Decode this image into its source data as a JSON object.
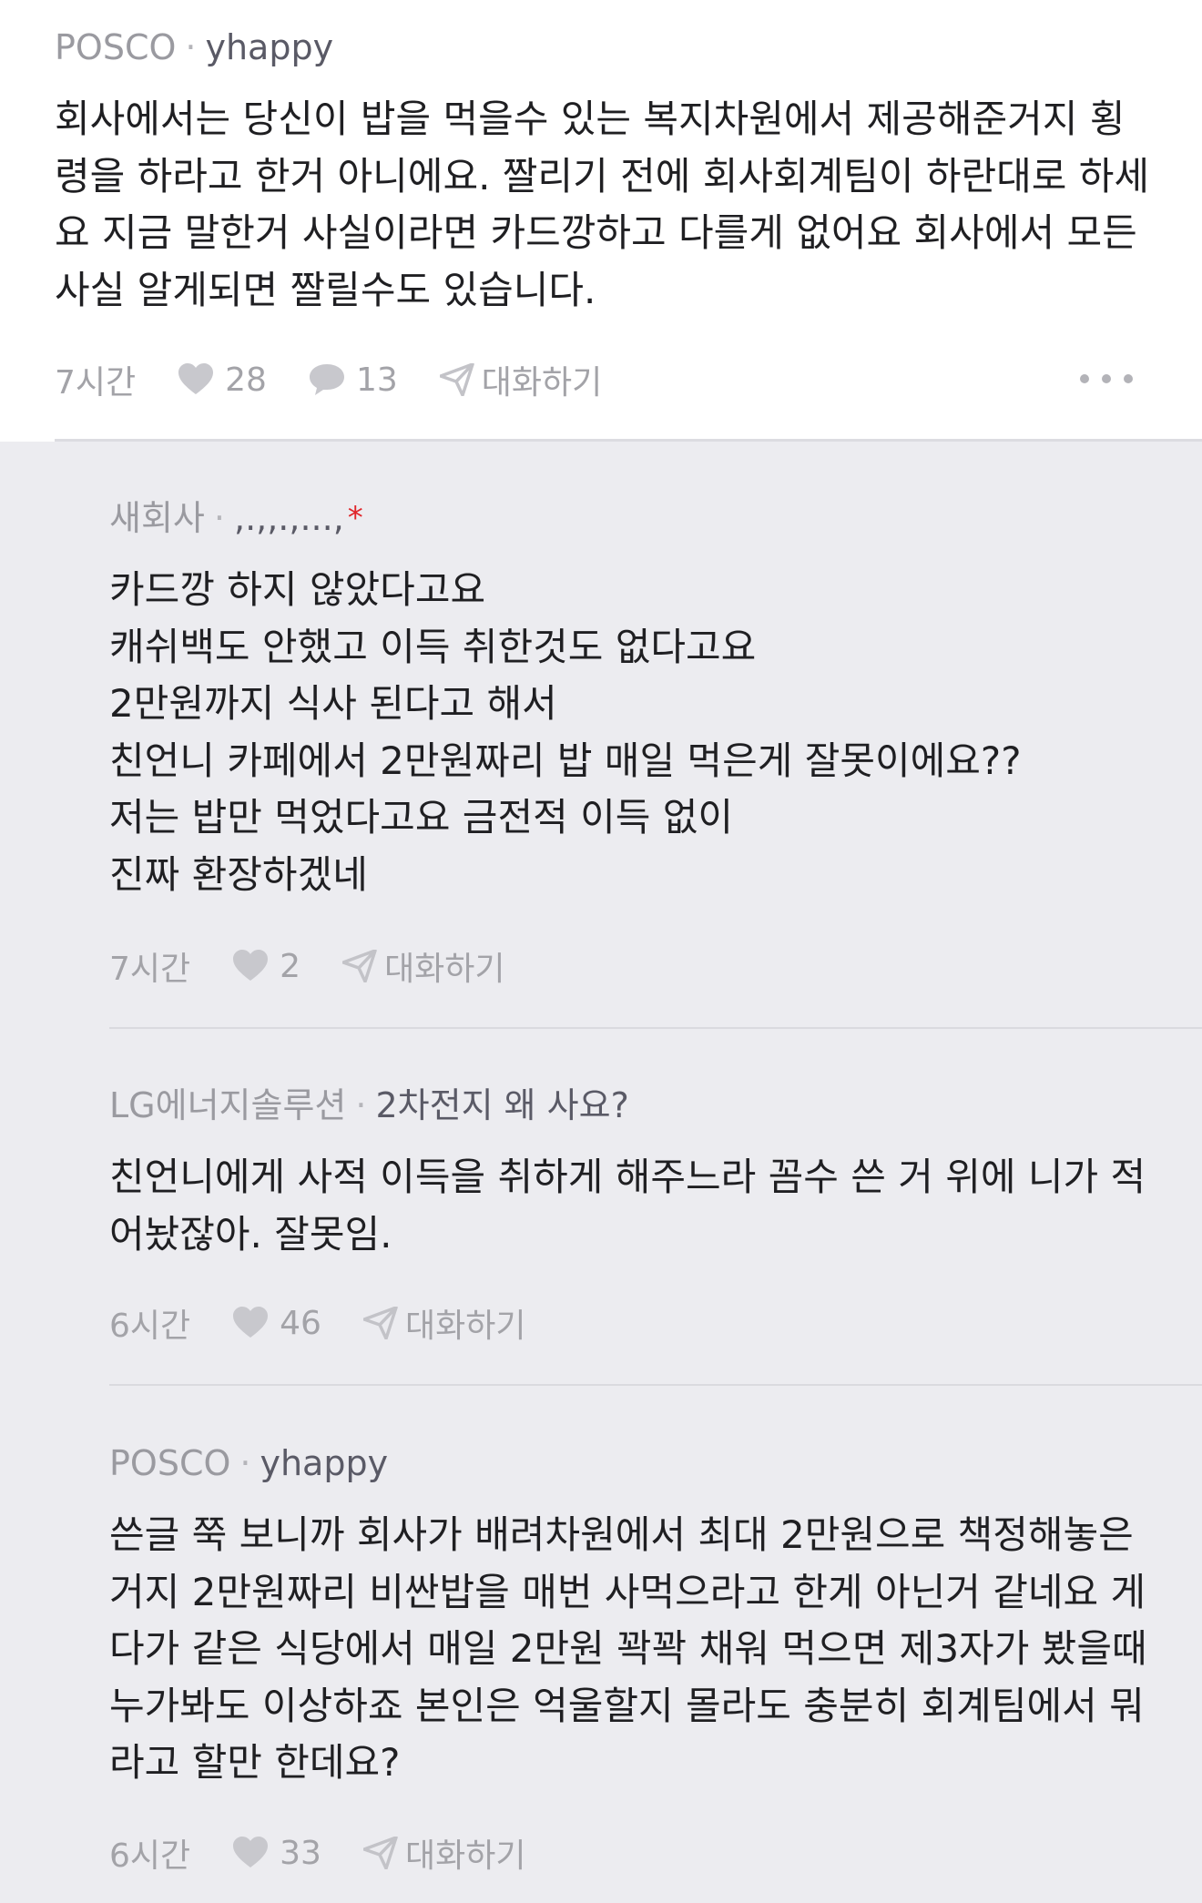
{
  "top_comment": {
    "company": "POSCO",
    "separator": "·",
    "nickname": "yhappy",
    "text": "회사에서는 당신이 밥을 먹을수 있는 복지차원에서 제공해준거지 횡\n령을 하라고 한거 아니에요. 짤리기 전에 회사회계팀이 하란대로 하세\n요 지금 말한거 사실이라면 카드깡하고 다를게 없어요 회사에서 모든\n사실 알게되면 짤릴수도 있습니다.",
    "time": "7시간",
    "likes": "28",
    "comments": "13",
    "reply_label": "대화하기"
  },
  "replies": [
    {
      "company": "새회사",
      "separator": "·",
      "nickname": ",.,,.,...,",
      "author_marker": "*",
      "text": "카드깡 하지 않았다고요\n캐쉬백도 안했고 이득 취한것도 없다고요\n2만원까지 식사 된다고 해서\n친언니 카페에서 2만원짜리 밥 매일 먹은게 잘못이에요??\n저는 밥만 먹었다고요 금전적 이득 없이\n진짜 환장하겠네",
      "time": "7시간",
      "likes": "2",
      "reply_label": "대화하기"
    },
    {
      "company": "LG에너지솔루션",
      "separator": "·",
      "nickname": "2차전지 왜 사요?",
      "text": "친언니에게 사적 이득을 취하게 해주느라 꼼수 쓴 거 위에 니가 적\n어놨잖아. 잘못임.",
      "time": "6시간",
      "likes": "46",
      "reply_label": "대화하기"
    },
    {
      "company": "POSCO",
      "separator": "·",
      "nickname": "yhappy",
      "text": "쓴글 쭉 보니까 회사가 배려차원에서 최대 2만원으로 책정해놓은\n거지 2만원짜리 비싼밥을 매번 사먹으라고 한게 아닌거 같네요 게\n다가 같은 식당에서 매일 2만원 꽉꽉 채워 먹으면 제3자가 봤을때\n누가봐도 이상하죠 본인은 억울할지 몰라도 충분히 회계팀에서 뭐\n라고 할만 한데요?",
      "time": "6시간",
      "likes": "33",
      "reply_label": "대화하기"
    }
  ],
  "icons": {
    "like": "heart-icon",
    "comment": "speech-bubble-icon",
    "reply": "paper-plane-icon",
    "more": "more-horizontal-icon"
  },
  "colors": {
    "background": "#ececf0",
    "card": "#ffffff",
    "meta_text": "#a3a3a8",
    "author_marker": "#e0262b"
  }
}
